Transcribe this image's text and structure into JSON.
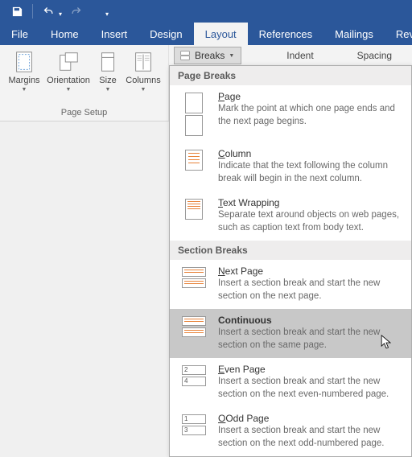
{
  "titlebar": {
    "save": "save",
    "undo": "undo",
    "redo": "redo"
  },
  "tabs": [
    {
      "label": "File"
    },
    {
      "label": "Home"
    },
    {
      "label": "Insert"
    },
    {
      "label": "Design"
    },
    {
      "label": "Layout",
      "active": true
    },
    {
      "label": "References"
    },
    {
      "label": "Mailings"
    },
    {
      "label": "Revie"
    }
  ],
  "ribbon": {
    "page_setup_label": "Page Setup",
    "items": [
      {
        "label": "Margins"
      },
      {
        "label": "Orientation"
      },
      {
        "label": "Size"
      },
      {
        "label": "Columns"
      }
    ],
    "breaks_button": "Breaks",
    "indent_label": "Indent",
    "spacing_label": "Spacing"
  },
  "dropdown": {
    "sections": [
      {
        "header": "Page Breaks",
        "items": [
          {
            "key": "P",
            "rest": "age",
            "desc": "Mark the point at which one page ends and the next page begins."
          },
          {
            "key": "C",
            "rest": "olumn",
            "desc": "Indicate that the text following the column break will begin in the next column."
          },
          {
            "key": "T",
            "rest": "ext Wrapping",
            "desc": "Separate text around objects on web pages, such as caption text from body text."
          }
        ]
      },
      {
        "header": "Section Breaks",
        "items": [
          {
            "key": "N",
            "rest": "ext Page",
            "desc": "Insert a section break and start the new section on the next page."
          },
          {
            "key": "",
            "rest": "Continuous",
            "bold": true,
            "hover": true,
            "desc": "Insert a section break and start the new section on the same page."
          },
          {
            "key": "E",
            "rest": "ven Page",
            "desc": "Insert a section break and start the new section on the next even-numbered page."
          },
          {
            "key": "",
            "rest": "Odd Page",
            "underlineFirst": "O",
            "desc": "Insert a section break and start the new section on the next odd-numbered page."
          }
        ]
      }
    ]
  }
}
